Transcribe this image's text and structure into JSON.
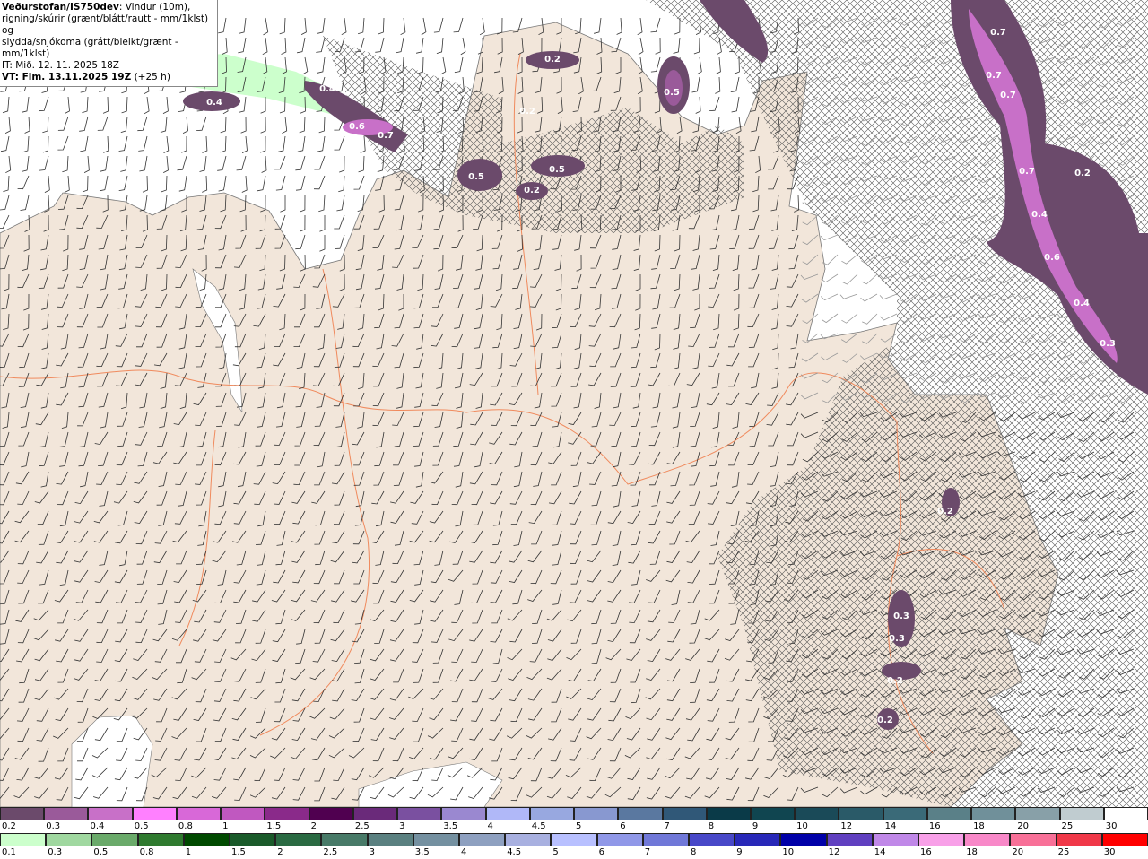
{
  "header": {
    "source": "Veðurstofan/IS750dev",
    "desc1": ": Vindur (10m),",
    "desc2": "rigning/skúrir (grænt/blátt/rautt - mm/1klst) og",
    "desc3": "slydda/snjókoma (grátt/bleikt/grænt - mm/1klst)",
    "it": "IT: Mið. 12. 11. 2025 18Z",
    "vt": "VT: Fim. 13.11.2025 19Z",
    "vt_offset": " (+25 h)"
  },
  "map": {
    "colors": {
      "land": "#f2e6da",
      "sea": "#ffffff",
      "roads": "#f08a5d",
      "precip_light": "#6b4a6b",
      "precip_mid": "#9a5a9a",
      "precip_high": "#ff80ff"
    },
    "precip_labels": [
      "0.4",
      "0.4",
      "0.6",
      "0.7",
      "0.2",
      "0.5",
      "0.2",
      "0.5",
      "0.5",
      "0.2",
      "0.7",
      "0.7",
      "0.7",
      "0.7",
      "0.2",
      "0.4",
      "0.6",
      "0.4",
      "0.3",
      "0.2",
      "0.3",
      "0.3",
      "0.2",
      "0.2"
    ]
  },
  "legend_snow_sleet": {
    "labels": [
      "0.2",
      "0.3",
      "0.4",
      "0.5",
      "0.8",
      "1",
      "1.5",
      "2",
      "2.5",
      "3",
      "3.5",
      "4",
      "4.5",
      "5",
      "6",
      "7",
      "8",
      "9",
      "10",
      "12",
      "14",
      "16",
      "18",
      "20",
      "25",
      "30"
    ],
    "colors": [
      "#6b4a6b",
      "#9a5a9a",
      "#c870c8",
      "#ff80ff",
      "#d868d8",
      "#c058c0",
      "#8a2a8a",
      "#500050",
      "#6a2a7a",
      "#7a50a0",
      "#9a88d0",
      "#b0b8f8",
      "#98a8e0",
      "#8898d0",
      "#5a78a0",
      "#305878",
      "#0a3a48",
      "#104550",
      "#1a4a58",
      "#2a5a68",
      "#3a6a78",
      "#5a8088",
      "#70909a",
      "#88a0a8",
      "#c0ccd0",
      "#ffffff"
    ]
  },
  "legend_rain": {
    "labels": [
      "0.1",
      "0.3",
      "0.5",
      "0.8",
      "1",
      "1.5",
      "2",
      "2.5",
      "3",
      "3.5",
      "4",
      "4.5",
      "5",
      "6",
      "7",
      "8",
      "9",
      "10",
      "12",
      "14",
      "16",
      "18",
      "20",
      "25",
      "30"
    ],
    "colors": [
      "#ccffcc",
      "#a0d8a0",
      "#6aaa6a",
      "#2f7a2f",
      "#004a00",
      "#1a5a2a",
      "#2a6a42",
      "#487a68",
      "#5a8080",
      "#7490a0",
      "#8ea0c0",
      "#a8b0e0",
      "#b8c0ff",
      "#9098e8",
      "#7078d8",
      "#4848c8",
      "#2828b8",
      "#0000a8",
      "#6040c0",
      "#c088e8",
      "#f8a0e8",
      "#f888c8",
      "#f87098",
      "#f03848",
      "#ff0000"
    ]
  }
}
